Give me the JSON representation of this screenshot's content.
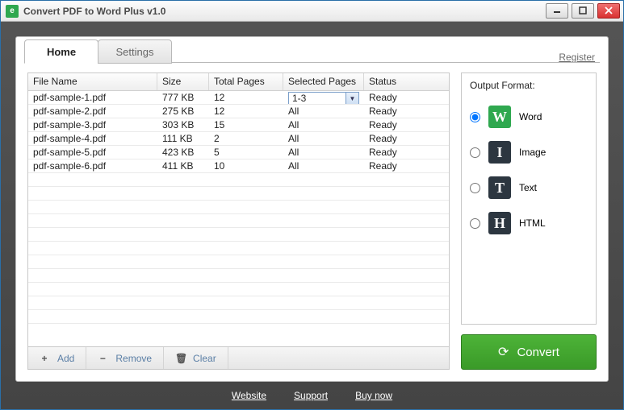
{
  "titlebar": {
    "title": "Convert PDF to Word Plus v1.0",
    "app_icon_letter": "e"
  },
  "tabs": {
    "home": "Home",
    "settings": "Settings"
  },
  "register_link": "Register",
  "columns": {
    "name": "File Name",
    "size": "Size",
    "pages": "Total Pages",
    "selected": "Selected Pages",
    "status": "Status"
  },
  "rows": [
    {
      "name": "pdf-sample-1.pdf",
      "size": "777 KB",
      "pages": "12",
      "selected": "1-3",
      "status": "Ready",
      "combo": true
    },
    {
      "name": "pdf-sample-2.pdf",
      "size": "275 KB",
      "pages": "12",
      "selected": "All",
      "status": "Ready",
      "combo": false
    },
    {
      "name": "pdf-sample-3.pdf",
      "size": "303 KB",
      "pages": "15",
      "selected": "All",
      "status": "Ready",
      "combo": false
    },
    {
      "name": "pdf-sample-4.pdf",
      "size": "111 KB",
      "pages": "2",
      "selected": "All",
      "status": "Ready",
      "combo": false
    },
    {
      "name": "pdf-sample-5.pdf",
      "size": "423 KB",
      "pages": "5",
      "selected": "All",
      "status": "Ready",
      "combo": false
    },
    {
      "name": "pdf-sample-6.pdf",
      "size": "411 KB",
      "pages": "10",
      "selected": "All",
      "status": "Ready",
      "combo": false
    }
  ],
  "actions": {
    "add": "Add",
    "remove": "Remove",
    "clear": "Clear"
  },
  "output": {
    "title": "Output Format:",
    "options": [
      {
        "key": "word",
        "label": "Word",
        "glyph": "W",
        "checked": true
      },
      {
        "key": "image",
        "label": "Image",
        "glyph": "I",
        "checked": false
      },
      {
        "key": "text",
        "label": "Text",
        "glyph": "T",
        "checked": false
      },
      {
        "key": "html",
        "label": "HTML",
        "glyph": "H",
        "checked": false
      }
    ]
  },
  "convert_label": "Convert",
  "footer": {
    "website": "Website",
    "support": "Support",
    "buy": "Buy now"
  }
}
